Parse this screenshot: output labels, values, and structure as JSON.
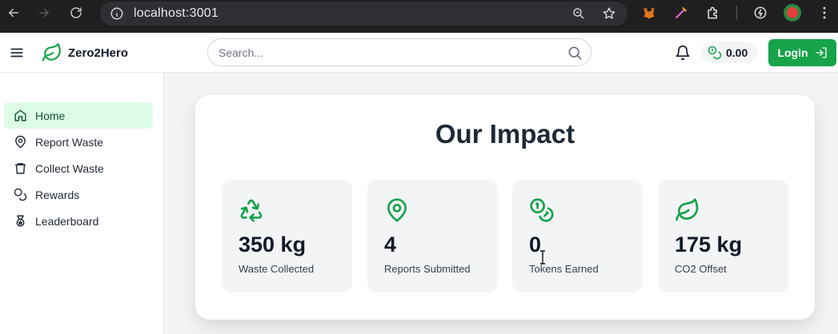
{
  "browser": {
    "url": "localhost:3001"
  },
  "header": {
    "app_name": "Zero2Hero",
    "search_placeholder": "Search...",
    "balance": "0.00",
    "login_label": "Login"
  },
  "sidebar": {
    "items": [
      {
        "label": "Home",
        "icon": "home-icon",
        "active": true
      },
      {
        "label": "Report Waste",
        "icon": "map-pin-icon",
        "active": false
      },
      {
        "label": "Collect Waste",
        "icon": "trash-icon",
        "active": false
      },
      {
        "label": "Rewards",
        "icon": "coins-icon",
        "active": false
      },
      {
        "label": "Leaderboard",
        "icon": "medal-icon",
        "active": false
      }
    ]
  },
  "impact": {
    "title": "Our Impact",
    "stats": [
      {
        "value": "350 kg",
        "label": "Waste Collected",
        "icon": "recycle-icon"
      },
      {
        "value": "4",
        "label": "Reports Submitted",
        "icon": "map-pin-icon"
      },
      {
        "value": "0",
        "label": "Tokens Earned",
        "icon": "coins-icon"
      },
      {
        "value": "175 kg",
        "label": "CO2 Offset",
        "icon": "leaf-icon"
      }
    ]
  },
  "colors": {
    "accent": "#16a34a",
    "active_bg": "#dcfce7"
  }
}
